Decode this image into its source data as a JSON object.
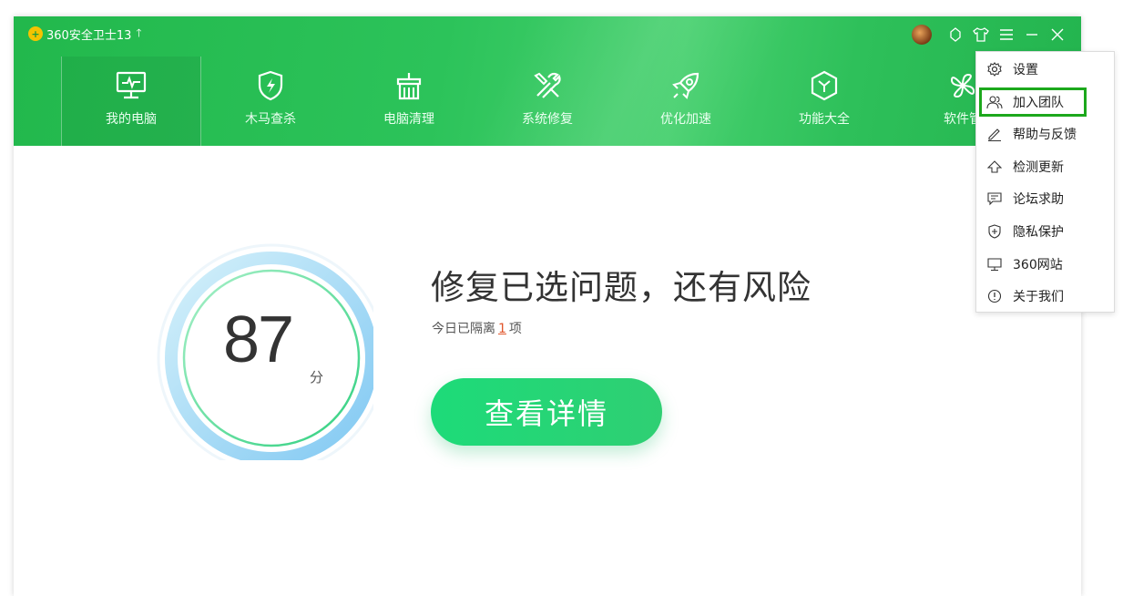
{
  "app": {
    "title": "360安全卫士13"
  },
  "nav": [
    {
      "label": "我的电脑",
      "icon": "monitor-icon"
    },
    {
      "label": "木马查杀",
      "icon": "shield-icon"
    },
    {
      "label": "电脑清理",
      "icon": "broom-icon"
    },
    {
      "label": "系统修复",
      "icon": "wrench-icon"
    },
    {
      "label": "优化加速",
      "icon": "rocket-icon"
    },
    {
      "label": "功能大全",
      "icon": "cube-icon"
    },
    {
      "label": "软件管",
      "icon": "software-icon"
    }
  ],
  "main": {
    "score": "87",
    "score_unit": "分",
    "headline": "修复已选问题，还有风险",
    "sub_prefix": "今日已隔离",
    "sub_count": "1",
    "sub_suffix": "项",
    "detail_button": "查看详情"
  },
  "menu": [
    {
      "label": "设置",
      "icon": "gear-icon"
    },
    {
      "label": "加入团队",
      "icon": "team-icon",
      "highlighted": true
    },
    {
      "label": "帮助与反馈",
      "icon": "pen-icon"
    },
    {
      "label": "检测更新",
      "icon": "arrow-up-icon"
    },
    {
      "label": "论坛求助",
      "icon": "message-icon"
    },
    {
      "label": "隐私保护",
      "icon": "privacy-shield-icon"
    },
    {
      "label": "360网站",
      "icon": "monitor-icon"
    },
    {
      "label": "关于我们",
      "icon": "info-icon"
    }
  ],
  "colors": {
    "brand_green": "#2cc35a",
    "button_green": "#1ddb79",
    "highlight_border": "#1ca81c",
    "count_red": "#e0552b"
  }
}
